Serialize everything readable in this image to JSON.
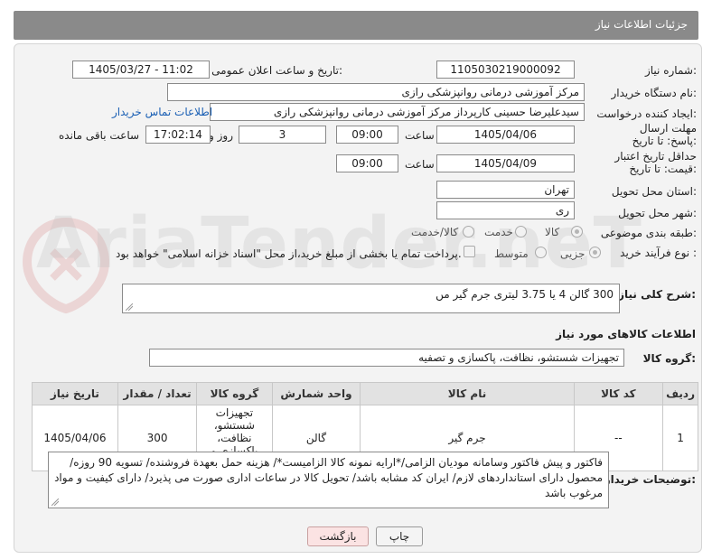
{
  "header": {
    "title": "جزئیات اطلاعات نیاز"
  },
  "fields": {
    "need_number": {
      "label": "شماره نیاز:",
      "value": "1105030219000092"
    },
    "announce_datetime": {
      "label": "تاریخ و ساعت اعلان عمومی:",
      "value": "1405/03/27 - 11:02"
    },
    "buyer_org": {
      "label": "نام دستگاه خریدار:",
      "value": "مرکز آموزشی درمانی روانپزشکی رازی"
    },
    "requester": {
      "label": "ایجاد کننده درخواست:",
      "value": "سیدعلیرضا حسینی کارپرداز مرکز آموزشی درمانی روانپزشکی رازی",
      "contact_link": "اطلاعات تماس خریدار"
    },
    "reply_deadline": {
      "label": "مهلت ارسال پاسخ: تا تاریخ:",
      "date": "1405/04/06",
      "time_label": "ساعت",
      "time": "09:00",
      "days": "3",
      "days_label": "روز و",
      "remaining": "17:02:14",
      "remaining_label": "ساعت باقی مانده"
    },
    "price_validity": {
      "label": "حداقل تاریخ اعتبار قیمت: تا تاریخ:",
      "date": "1405/04/09",
      "time_label": "ساعت",
      "time": "09:00"
    },
    "province": {
      "label": "استان محل تحویل:",
      "value": "تهران"
    },
    "city": {
      "label": "شهر محل تحویل:",
      "value": "ری"
    },
    "category": {
      "label": "طبقه بندی موضوعی:",
      "options": [
        "کالا",
        "خدمت",
        "کالا/خدمت"
      ],
      "selected": "کالا"
    },
    "purchase_type": {
      "label": "نوع فرآیند خرید :",
      "options": [
        "جزیی",
        "متوسط"
      ],
      "selected": "جزیی",
      "payment_note": "پرداخت تمام یا بخشی از مبلغ خرید،از محل \"اسناد خزانه اسلامی\" خواهد بود."
    }
  },
  "summary": {
    "label": "شرح کلی نیاز:",
    "value": "300 گالن 4 یا 3.75 لیتری جرم گیر مں"
  },
  "goods_info": {
    "title": "اطلاعات کالاهای مورد نیاز"
  },
  "goods_group": {
    "label": "گروه کالا:",
    "value": "تجهیزات شستشو، نظافت، پاکسازی و تصفیه"
  },
  "table": {
    "headers": [
      "ردیف",
      "کد کالا",
      "نام کالا",
      "واحد شمارش",
      "گروه کالا",
      "تعداد / مقدار",
      "تاریخ نیاز"
    ],
    "rows": [
      [
        "1",
        "--",
        "جرم گیر",
        "گالن",
        "تجهیزات شستشو، نظافت، پاکسازی و تصفیه",
        "300",
        "1405/04/06"
      ]
    ]
  },
  "buyer_notes": {
    "label": "توضیحات خریدار:",
    "value": "فاکتور و پیش فاکتور وسامانه مودیان الزامی/*ارایه نمونه کالا الزامیست*/ هزینه حمل بعهدة فروشنده/ تسویه 90 روزه/ محصول دارای استانداردهای لازم/ ایران کد مشابه باشد/ تحویل کالا در ساعات اداری صورت می پذیرد/ دارای کیفیت و مواد مرغوب باشد"
  },
  "buttons": {
    "print": "چاپ",
    "back": "بازگشت"
  },
  "watermark": {
    "text": "AriaTender.neT"
  }
}
